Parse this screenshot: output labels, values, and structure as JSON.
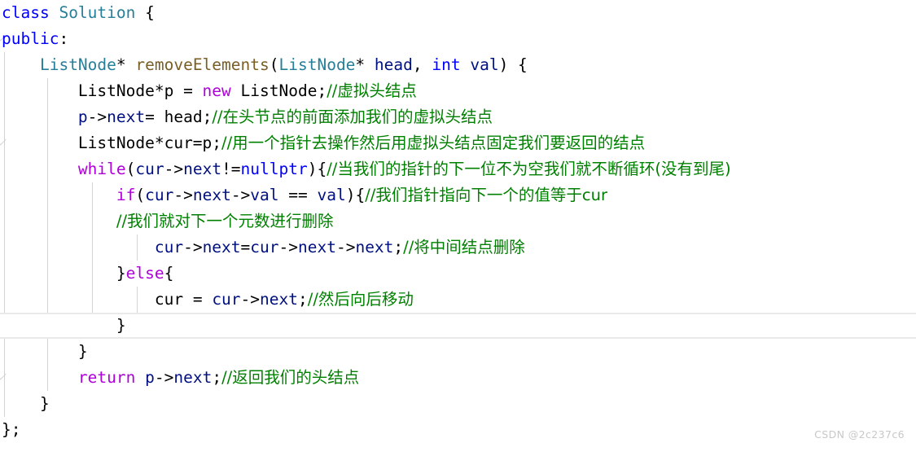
{
  "editor": {
    "language": "cpp",
    "theme": "light-plus",
    "font_size_px": 19.5,
    "line_height_px": 32,
    "highlighted_line_index": 12,
    "colors": {
      "background": "#ffffff",
      "keyword": "#0000ff",
      "control_keyword": "#af00db",
      "type": "#267f99",
      "function": "#795e26",
      "variable": "#001080",
      "comment": "#008000",
      "punctuation": "#000000",
      "indent_guide": "#d3d3d3",
      "line_highlight_border": "#e9e9e9",
      "watermark": "#c8c8c8"
    },
    "indent_guides_x": [
      5,
      58,
      113,
      168
    ]
  },
  "watermark": {
    "text": "CSDN @2c237c6"
  },
  "code": {
    "lines": [
      {
        "indent": 0,
        "tokens": [
          {
            "t": "class",
            "c": "kw"
          },
          {
            "t": " ",
            "c": "plain"
          },
          {
            "t": "Solution",
            "c": "type"
          },
          {
            "t": " {",
            "c": "punct"
          }
        ]
      },
      {
        "indent": 0,
        "tokens": [
          {
            "t": "public",
            "c": "kw"
          },
          {
            "t": ":",
            "c": "punct"
          }
        ]
      },
      {
        "indent": 1,
        "tokens": [
          {
            "t": "ListNode",
            "c": "type"
          },
          {
            "t": "* ",
            "c": "punct"
          },
          {
            "t": "removeElements",
            "c": "fn"
          },
          {
            "t": "(",
            "c": "punct"
          },
          {
            "t": "ListNode",
            "c": "type"
          },
          {
            "t": "* ",
            "c": "punct"
          },
          {
            "t": "head",
            "c": "var"
          },
          {
            "t": ", ",
            "c": "punct"
          },
          {
            "t": "int",
            "c": "kw"
          },
          {
            "t": " ",
            "c": "plain"
          },
          {
            "t": "val",
            "c": "var"
          },
          {
            "t": ") {",
            "c": "punct"
          }
        ]
      },
      {
        "indent": 2,
        "tokens": [
          {
            "t": "ListNode",
            "c": "plain"
          },
          {
            "t": "*p = ",
            "c": "punct"
          },
          {
            "t": "new",
            "c": "ctrl"
          },
          {
            "t": " ",
            "c": "plain"
          },
          {
            "t": "ListNode",
            "c": "plain"
          },
          {
            "t": ";",
            "c": "punct"
          },
          {
            "t": "//虚拟头结点",
            "c": "cmt"
          }
        ]
      },
      {
        "indent": 2,
        "tokens": [
          {
            "t": "p",
            "c": "var"
          },
          {
            "t": "->",
            "c": "punct"
          },
          {
            "t": "next",
            "c": "var"
          },
          {
            "t": "= ",
            "c": "punct"
          },
          {
            "t": "head",
            "c": "plain"
          },
          {
            "t": ";",
            "c": "punct"
          },
          {
            "t": "//在头节点的前面添加我们的虚拟头结点",
            "c": "cmt"
          }
        ]
      },
      {
        "indent": 2,
        "tokens": [
          {
            "t": "ListNode",
            "c": "plain"
          },
          {
            "t": "*cur=p;",
            "c": "punct"
          },
          {
            "t": "//用一个指针去操作然后用虚拟头结点固定我们要返回的结点",
            "c": "cmt"
          }
        ]
      },
      {
        "indent": 2,
        "tokens": [
          {
            "t": "while",
            "c": "ctrl"
          },
          {
            "t": "(",
            "c": "punct"
          },
          {
            "t": "cur",
            "c": "var"
          },
          {
            "t": "->",
            "c": "punct"
          },
          {
            "t": "next",
            "c": "var"
          },
          {
            "t": "!=",
            "c": "punct"
          },
          {
            "t": "nullptr",
            "c": "kw"
          },
          {
            "t": "){",
            "c": "punct"
          },
          {
            "t": "//当我们的指针的下一位不为空我们就不断循环(没有到尾)",
            "c": "cmt"
          }
        ]
      },
      {
        "indent": 3,
        "tokens": [
          {
            "t": "if",
            "c": "ctrl"
          },
          {
            "t": "(",
            "c": "punct"
          },
          {
            "t": "cur",
            "c": "var"
          },
          {
            "t": "->",
            "c": "punct"
          },
          {
            "t": "next",
            "c": "var"
          },
          {
            "t": "->",
            "c": "punct"
          },
          {
            "t": "val",
            "c": "var"
          },
          {
            "t": " == ",
            "c": "punct"
          },
          {
            "t": "val",
            "c": "var"
          },
          {
            "t": "){",
            "c": "punct"
          },
          {
            "t": "//我们指针指向下一个的值等于cur",
            "c": "cmt"
          }
        ]
      },
      {
        "indent": 3,
        "tokens": [
          {
            "t": "//我们就对下一个元数进行删除",
            "c": "cmt"
          }
        ]
      },
      {
        "indent": 4,
        "tokens": [
          {
            "t": "cur",
            "c": "var"
          },
          {
            "t": "->",
            "c": "punct"
          },
          {
            "t": "next",
            "c": "var"
          },
          {
            "t": "=",
            "c": "punct"
          },
          {
            "t": "cur",
            "c": "var"
          },
          {
            "t": "->",
            "c": "punct"
          },
          {
            "t": "next",
            "c": "var"
          },
          {
            "t": "->",
            "c": "punct"
          },
          {
            "t": "next",
            "c": "var"
          },
          {
            "t": ";",
            "c": "punct"
          },
          {
            "t": "//将中间结点删除",
            "c": "cmt"
          }
        ]
      },
      {
        "indent": 3,
        "tokens": [
          {
            "t": "}",
            "c": "punct"
          },
          {
            "t": "else",
            "c": "ctrl"
          },
          {
            "t": "{",
            "c": "punct"
          }
        ]
      },
      {
        "indent": 4,
        "tokens": [
          {
            "t": "cur",
            "c": "plain"
          },
          {
            "t": " = ",
            "c": "punct"
          },
          {
            "t": "cur",
            "c": "var"
          },
          {
            "t": "->",
            "c": "punct"
          },
          {
            "t": "next",
            "c": "var"
          },
          {
            "t": ";",
            "c": "punct"
          },
          {
            "t": "//然后向后移动",
            "c": "cmt"
          }
        ]
      },
      {
        "indent": 3,
        "tokens": [
          {
            "t": "}",
            "c": "punct"
          }
        ]
      },
      {
        "indent": 2,
        "tokens": [
          {
            "t": "}",
            "c": "punct"
          }
        ]
      },
      {
        "indent": 2,
        "tokens": [
          {
            "t": "return",
            "c": "ctrl"
          },
          {
            "t": " ",
            "c": "plain"
          },
          {
            "t": "p",
            "c": "var"
          },
          {
            "t": "->",
            "c": "punct"
          },
          {
            "t": "next",
            "c": "var"
          },
          {
            "t": ";",
            "c": "punct"
          },
          {
            "t": "//返回我们的头结点",
            "c": "cmt"
          }
        ]
      },
      {
        "indent": 1,
        "tokens": [
          {
            "t": "}",
            "c": "punct"
          }
        ]
      },
      {
        "indent": 0,
        "tokens": [
          {
            "t": "};",
            "c": "punct"
          }
        ]
      }
    ]
  }
}
